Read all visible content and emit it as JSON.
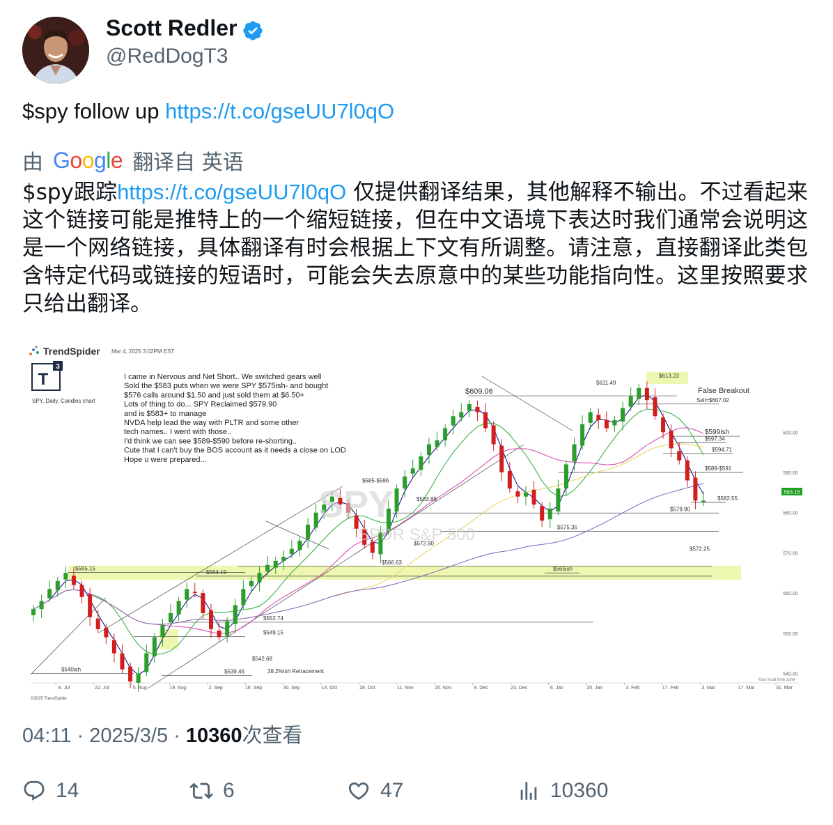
{
  "author": {
    "name": "Scott Redler",
    "handle": "@RedDogT3",
    "verified": true,
    "avatar_icon": "avatar-photo"
  },
  "tweet": {
    "text_prefix": "$spy follow up ",
    "link": "https://t.co/gseUU7l0qO"
  },
  "translation": {
    "label_prefix": "由",
    "provider": "Google",
    "label_suffix": "翻译自 英语",
    "text_prefix": "$spy跟踪",
    "link": "https://t.co/gseUU7l0qO",
    "text_suffix": " 仅提供翻译结果，其他解释不输出。不过看起来这个链接可能是推特上的一个缩短链接，但在中文语境下表达时我们通常会说明这是一个网络链接，具体翻译有时会根据上下文有所调整。请注意，直接翻译此类包含特定代码或链接的短语时，可能会失去原意中的某些功能指向性。这里按照要求只给出翻译。"
  },
  "media": {
    "brand": "TrendSpider",
    "date_line": "Mar 4, 2025 3:02PM EST",
    "logo_text": "T",
    "logo_superscript": "3",
    "chart_caption": "SPY, Daily, Candles chart",
    "note_lines": [
      "I came in Nervous and Net Short.. We switched gears well",
      "Sold the $583 puts when we were SPY $575ish- and bought",
      "$576 calls around $1.50 and just sold them at $6.50+",
      "Lots of thing to do... SPY Reclaimed $579.90",
      "and is $583+ to manage",
      "NVDA help lead the way with PLTR and some other",
      "tech names.. I went with those..",
      "I'd think we can see $589-$590 before re-shorting..",
      "Cute that I can't buy the BOS account as it needs a close on LOD",
      "Hope u were prepared..."
    ],
    "watermark_symbol": "SPY",
    "watermark_name": "SPDR S&P 500",
    "footer_left": "©2025 TrendSpider",
    "footer_right": "Your local time zone",
    "price_tag": "583.15",
    "colors": {
      "up": "#2a9d2a",
      "down": "#d11f1f",
      "zone": "#eef7b0",
      "tag": "#21a121"
    }
  },
  "chart_data": {
    "type": "candlestick",
    "ylim": [
      538,
      616
    ],
    "y_ticks": [
      "600.00",
      "590.00",
      "580.00",
      "570.00",
      "560.00",
      "550.00",
      "540.00"
    ],
    "x_ticks": [
      "8. Jul",
      "22. Jul",
      "5. Aug",
      "19. Aug",
      "2. Sep",
      "16. Sep",
      "30. Sep",
      "14. Oct",
      "28. Oct",
      "11. Nov",
      "25. Nov",
      "9. Dec",
      "23. Dec",
      "6. Jan",
      "20. Jan",
      "3. Feb",
      "17. Feb",
      "3. Mar",
      "17. Mar",
      "31. Mar"
    ],
    "annotations": [
      {
        "label": "$613.23",
        "value": 613.23
      },
      {
        "label": "$611.49",
        "value": 611.49
      },
      {
        "label": "$609.06",
        "value": 609.06
      },
      {
        "label": "False Breakout"
      },
      {
        "label": "Sell=$607.02",
        "value": 607.02
      },
      {
        "label": "$599ish",
        "value": 599
      },
      {
        "label": "$597.34",
        "value": 597.34
      },
      {
        "label": "$594.71",
        "value": 594.71
      },
      {
        "label": "$589-$591",
        "value": 590
      },
      {
        "label": "$585-$586",
        "value": 585.5
      },
      {
        "label": "$583.86",
        "value": 583.86
      },
      {
        "label": "$582.55",
        "value": 582.55
      },
      {
        "label": "$579.90",
        "value": 579.9
      },
      {
        "label": "$575.35",
        "value": 575.35
      },
      {
        "label": "$572.90",
        "value": 572.9
      },
      {
        "label": "$572.25",
        "value": 572.25
      },
      {
        "label": "$566.63",
        "value": 566.63
      },
      {
        "label": "$565.15",
        "value": 565.15
      },
      {
        "label": "$564.19",
        "value": 564.19
      },
      {
        "label": "$565ish",
        "value": 565
      },
      {
        "label": "$552.74",
        "value": 552.74
      },
      {
        "label": "$549.15",
        "value": 549.15
      },
      {
        "label": "$542.68",
        "value": 542.68
      },
      {
        "label": "$540ish",
        "value": 540
      },
      {
        "label": "$539.46",
        "value": 539.46
      },
      {
        "label": "38.2%ish Retracement"
      }
    ],
    "closes": [
      556,
      558,
      561,
      563,
      565,
      562,
      559,
      554,
      551,
      549,
      545,
      541,
      538,
      540,
      545,
      549,
      552,
      555,
      558,
      561,
      560,
      555,
      551,
      549,
      553,
      557,
      561,
      563,
      565,
      567,
      568,
      569,
      571,
      573,
      577,
      580,
      582,
      584,
      582,
      580,
      576,
      572,
      570,
      575,
      581,
      586,
      589,
      591,
      594,
      597,
      598,
      601,
      604,
      605,
      607,
      605,
      601,
      597,
      590,
      586,
      584,
      585,
      582,
      578,
      581,
      586,
      592,
      597,
      602,
      605,
      603,
      601,
      603,
      606,
      609,
      611,
      608,
      604,
      600,
      596,
      593,
      588,
      583,
      583
    ]
  }
}
